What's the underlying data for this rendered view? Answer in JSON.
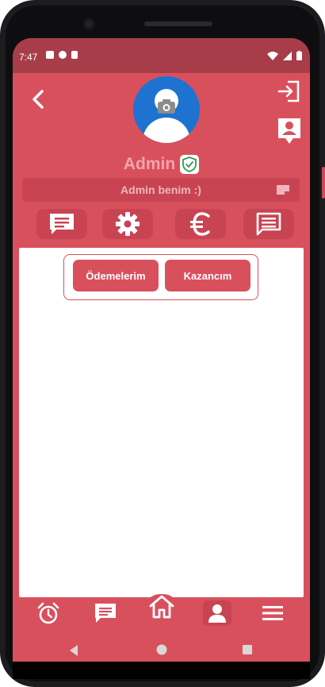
{
  "status": {
    "time": "7:47"
  },
  "header": {
    "back_icon": "chevron-left-icon",
    "logout_icon": "logout-icon",
    "profile_card_icon": "contact-card-icon"
  },
  "profile": {
    "name": "Admin",
    "bio": "Admin benim :)",
    "avatar_color": "#1e73d1",
    "verified_color": "#2e9e4f"
  },
  "actions": [
    {
      "icon": "chat-icon"
    },
    {
      "icon": "gear-icon"
    },
    {
      "icon": "euro-icon"
    },
    {
      "icon": "message-list-icon"
    }
  ],
  "tabs": [
    {
      "label": "Ödemelerim"
    },
    {
      "label": "Kazancım"
    }
  ],
  "bottom_nav": [
    {
      "icon": "alarm-icon"
    },
    {
      "icon": "chat-icon"
    },
    {
      "icon": "home-icon"
    },
    {
      "icon": "user-icon",
      "active": true
    },
    {
      "icon": "menu-icon"
    }
  ],
  "colors": {
    "primary": "#d9505d",
    "primary_dark": "#c84452",
    "statusbar": "#a83d4a",
    "name_text": "#f3a4ad"
  }
}
